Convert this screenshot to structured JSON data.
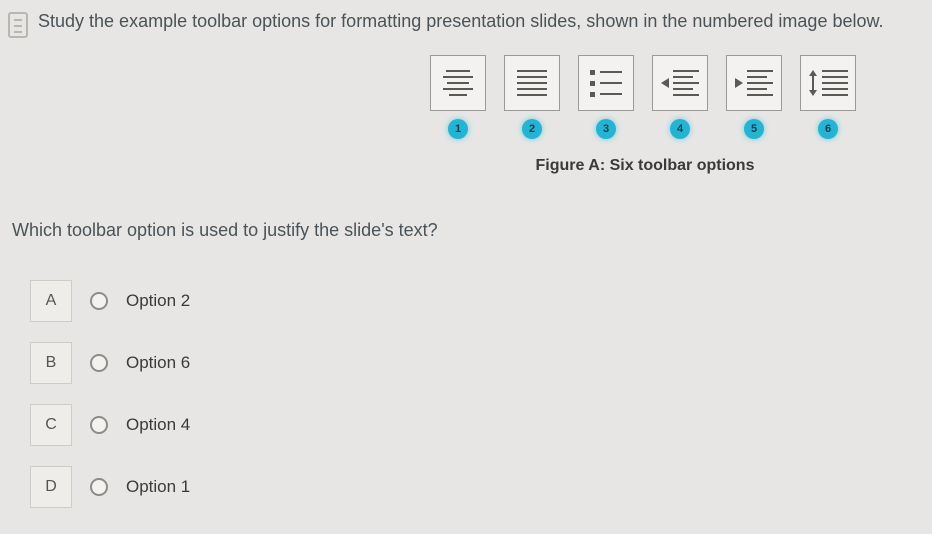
{
  "instruction": "Study the example toolbar options for formatting presentation slides, shown in the numbered image below.",
  "figure": {
    "badges": [
      "1",
      "2",
      "3",
      "4",
      "5",
      "6"
    ],
    "caption": "Figure A: Six toolbar options"
  },
  "question": "Which toolbar option is used to justify the slide's text?",
  "options": [
    {
      "letter": "A",
      "label": "Option 2"
    },
    {
      "letter": "B",
      "label": "Option 6"
    },
    {
      "letter": "C",
      "label": "Option 4"
    },
    {
      "letter": "D",
      "label": "Option 1"
    }
  ]
}
